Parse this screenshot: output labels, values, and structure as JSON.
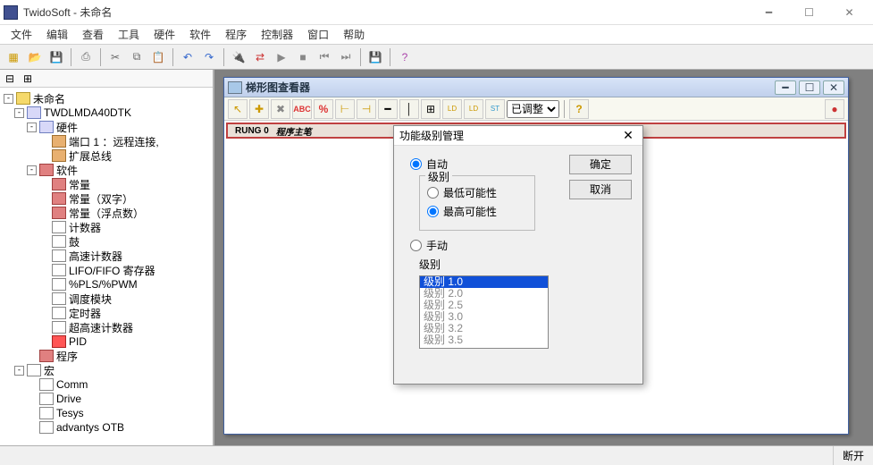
{
  "window": {
    "title": "TwidoSoft - 未命名"
  },
  "menu": [
    "文件",
    "编辑",
    "查看",
    "工具",
    "硬件",
    "软件",
    "程序",
    "控制器",
    "窗口",
    "帮助"
  ],
  "tree": {
    "root": "未命名",
    "device": "TWDLMDA40DTK",
    "hardware": {
      "label": "硬件",
      "port": "端口 1 ：远程连接,",
      "bus": "扩展总线"
    },
    "software": {
      "label": "软件",
      "items": [
        "常量",
        "常量（双字）",
        "常量（浮点数）",
        "计数器",
        "鼓",
        "高速计数器",
        "LIFO/FIFO 寄存器",
        "%PLS/%PWM",
        "调度模块",
        "定时器",
        "超高速计数器",
        "PID"
      ]
    },
    "program": "程序",
    "macros": {
      "label": "宏",
      "items": [
        "Comm",
        "Drive",
        "Tesys",
        "advantys OTB"
      ]
    }
  },
  "viewer": {
    "title": "梯形图查看器",
    "dropdown": "已调整",
    "rung": "RUNG 0",
    "rung_label": "程序主笔"
  },
  "dialog": {
    "title": "功能级别管理",
    "auto": "自动",
    "group1": "级别",
    "opt_low": "最低可能性",
    "opt_high": "最高可能性",
    "manual": "手动",
    "group2": "级别",
    "levels": [
      "级别 1.0",
      "级别 2.0",
      "级别 2.5",
      "级别 3.0",
      "级别 3.2",
      "级别 3.5"
    ],
    "ok": "确定",
    "cancel": "取消"
  },
  "status": {
    "disconnect": "断开"
  }
}
